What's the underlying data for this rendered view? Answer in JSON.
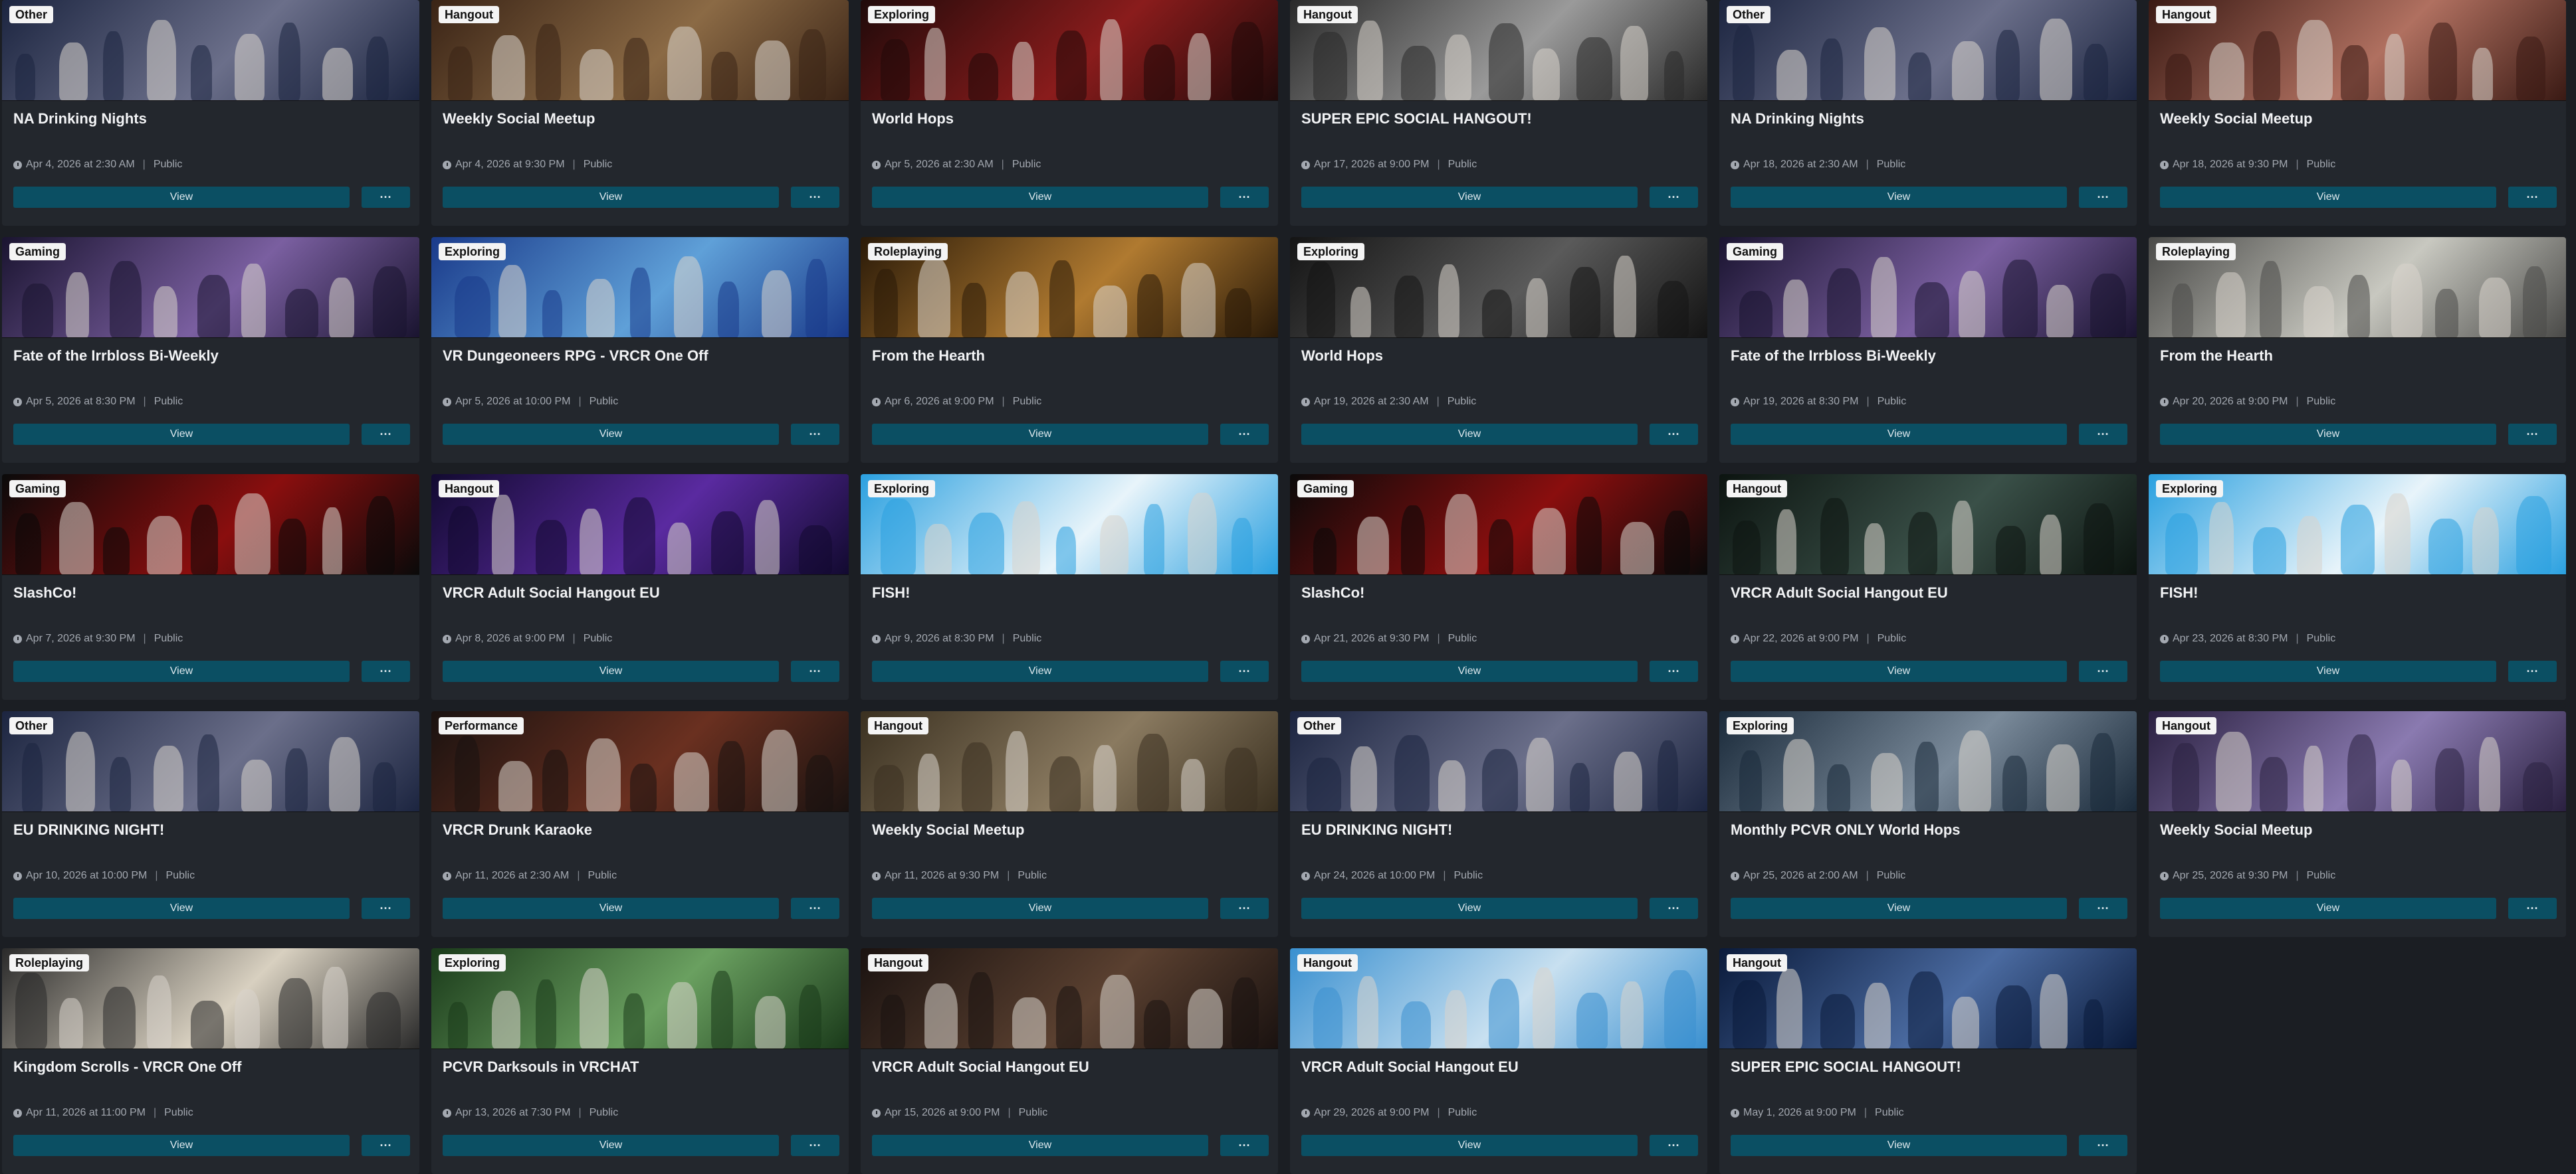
{
  "buttons": {
    "view_label": "View",
    "more_label": "···"
  },
  "meta": {
    "separator": "|",
    "clock_icon": "clock-icon"
  },
  "events": [
    {
      "category": "Other",
      "title": "NA Drinking Nights",
      "date": "Apr 4, 2026 at 2:30 AM",
      "visibility": "Public",
      "bg": [
        "#1c2540",
        "#6b6f8a"
      ]
    },
    {
      "category": "Hangout",
      "title": "Weekly Social Meetup",
      "date": "Apr 4, 2026 at 9:30 PM",
      "visibility": "Public",
      "bg": [
        "#3a2416",
        "#8b6a45"
      ]
    },
    {
      "category": "Exploring",
      "title": "World Hops",
      "date": "Apr 5, 2026 at 2:30 AM",
      "visibility": "Public",
      "bg": [
        "#200a0a",
        "#8a1c1c"
      ]
    },
    {
      "category": "Hangout",
      "title": "SUPER EPIC SOCIAL HANGOUT!",
      "date": "Apr 17, 2026 at 9:00 PM",
      "visibility": "Public",
      "bg": [
        "#2a2a2a",
        "#9a9a9a"
      ]
    },
    {
      "category": "Other",
      "title": "NA Drinking Nights",
      "date": "Apr 18, 2026 at 2:30 AM",
      "visibility": "Public",
      "bg": [
        "#1c2540",
        "#6b6f8a"
      ]
    },
    {
      "category": "Hangout",
      "title": "Weekly Social Meetup",
      "date": "Apr 18, 2026 at 9:30 PM",
      "visibility": "Public",
      "bg": [
        "#3a1a14",
        "#b07060"
      ]
    },
    {
      "category": "Gaming",
      "title": "Fate of the Irrbloss Bi-Weekly",
      "date": "Apr 5, 2026 at 8:30 PM",
      "visibility": "Public",
      "bg": [
        "#1a1430",
        "#7a5fa0"
      ]
    },
    {
      "category": "Exploring",
      "title": "VR Dungeoneers RPG - VRCR One Off",
      "date": "Apr 5, 2026 at 10:00 PM",
      "visibility": "Public",
      "bg": [
        "#1a3a8a",
        "#5fa0d8"
      ]
    },
    {
      "category": "Roleplaying",
      "title": "From the Hearth",
      "date": "Apr 6, 2026 at 9:00 PM",
      "visibility": "Public",
      "bg": [
        "#2a1a08",
        "#b07a30"
      ]
    },
    {
      "category": "Exploring",
      "title": "World Hops",
      "date": "Apr 19, 2026 at 2:30 AM",
      "visibility": "Public",
      "bg": [
        "#141414",
        "#5a5a5a"
      ]
    },
    {
      "category": "Gaming",
      "title": "Fate of the Irrbloss Bi-Weekly",
      "date": "Apr 19, 2026 at 8:30 PM",
      "visibility": "Public",
      "bg": [
        "#1a1430",
        "#7a5fa0"
      ]
    },
    {
      "category": "Roleplaying",
      "title": "From the Hearth",
      "date": "Apr 20, 2026 at 9:00 PM",
      "visibility": "Public",
      "bg": [
        "#4a4a48",
        "#c8c8c0"
      ]
    },
    {
      "category": "Gaming",
      "title": "SlashCo!",
      "date": "Apr 7, 2026 at 9:30 PM",
      "visibility": "Public",
      "bg": [
        "#0a0a0a",
        "#8a0e0e"
      ]
    },
    {
      "category": "Hangout",
      "title": "VRCR Adult Social Hangout EU",
      "date": "Apr 8, 2026 at 9:00 PM",
      "visibility": "Public",
      "bg": [
        "#120a30",
        "#5a2aa0"
      ]
    },
    {
      "category": "Exploring",
      "title": "FISH!",
      "date": "Apr 9, 2026 at 8:30 PM",
      "visibility": "Public",
      "bg": [
        "#2aa0e0",
        "#e8f4fa"
      ]
    },
    {
      "category": "Gaming",
      "title": "SlashCo!",
      "date": "Apr 21, 2026 at 9:30 PM",
      "visibility": "Public",
      "bg": [
        "#0a0a0a",
        "#8a0e0e"
      ]
    },
    {
      "category": "Hangout",
      "title": "VRCR Adult Social Hangout EU",
      "date": "Apr 22, 2026 at 9:00 PM",
      "visibility": "Public",
      "bg": [
        "#0c1410",
        "#3a5048"
      ]
    },
    {
      "category": "Exploring",
      "title": "FISH!",
      "date": "Apr 23, 2026 at 8:30 PM",
      "visibility": "Public",
      "bg": [
        "#2aa0e0",
        "#e8f4fa"
      ]
    },
    {
      "category": "Other",
      "title": "EU DRINKING NIGHT!",
      "date": "Apr 10, 2026 at 10:00 PM",
      "visibility": "Public",
      "bg": [
        "#1c2540",
        "#6b6f8a"
      ]
    },
    {
      "category": "Performance",
      "title": "VRCR Drunk Karaoke",
      "date": "Apr 11, 2026 at 2:30 AM",
      "visibility": "Public",
      "bg": [
        "#1a1210",
        "#6a3020"
      ]
    },
    {
      "category": "Hangout",
      "title": "Weekly Social Meetup",
      "date": "Apr 11, 2026 at 9:30 PM",
      "visibility": "Public",
      "bg": [
        "#3a3020",
        "#8a7a60"
      ]
    },
    {
      "category": "Other",
      "title": "EU DRINKING NIGHT!",
      "date": "Apr 24, 2026 at 10:00 PM",
      "visibility": "Public",
      "bg": [
        "#1c2540",
        "#6b6f8a"
      ]
    },
    {
      "category": "Exploring",
      "title": "Monthly PCVR ONLY World Hops",
      "date": "Apr 25, 2026 at 2:00 AM",
      "visibility": "Public",
      "bg": [
        "#1a2a3a",
        "#7a8a9a"
      ]
    },
    {
      "category": "Hangout",
      "title": "Weekly Social Meetup",
      "date": "Apr 25, 2026 at 9:30 PM",
      "visibility": "Public",
      "bg": [
        "#2a2040",
        "#8a7ab0"
      ]
    },
    {
      "category": "Roleplaying",
      "title": "Kingdom Scrolls - VRCR One Off",
      "date": "Apr 11, 2026 at 11:00 PM",
      "visibility": "Public",
      "bg": [
        "#2a2a2a",
        "#d8d0c0"
      ]
    },
    {
      "category": "Exploring",
      "title": "PCVR Darksouls in VRCHAT",
      "date": "Apr 13, 2026 at 7:30 PM",
      "visibility": "Public",
      "bg": [
        "#1a3a1a",
        "#6aa060"
      ]
    },
    {
      "category": "Hangout",
      "title": "VRCR Adult Social Hangout EU",
      "date": "Apr 15, 2026 at 9:00 PM",
      "visibility": "Public",
      "bg": [
        "#1a1210",
        "#5a4030"
      ]
    },
    {
      "category": "Hangout",
      "title": "VRCR Adult Social Hangout EU",
      "date": "Apr 29, 2026 at 9:00 PM",
      "visibility": "Public",
      "bg": [
        "#3a90d0",
        "#c8e0f0"
      ]
    },
    {
      "category": "Hangout",
      "title": "SUPER EPIC SOCIAL HANGOUT!",
      "date": "May 1, 2026 at 9:00 PM",
      "visibility": "Public",
      "bg": [
        "#0a1a3a",
        "#4a6aa0"
      ]
    }
  ]
}
